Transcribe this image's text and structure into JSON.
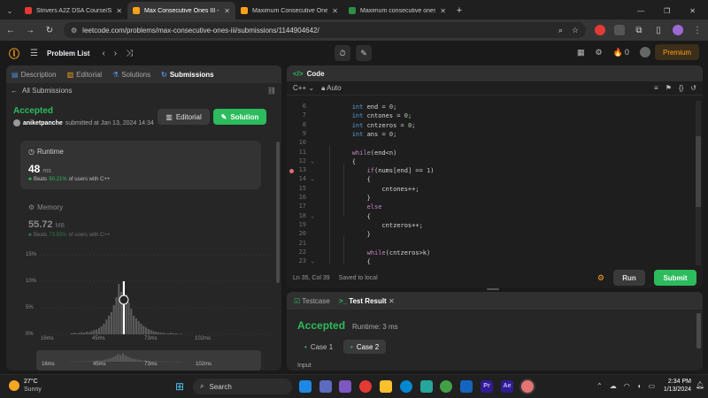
{
  "browser": {
    "tabs": [
      {
        "title": "Strivers A2Z DSA Course/Sheet",
        "color": "#e53935"
      },
      {
        "title": "Max Consecutive Ones III - Leet",
        "color": "#ffa116"
      },
      {
        "title": "Maximum Consecutive Ones - L",
        "color": "#ffa116"
      },
      {
        "title": "Maximum consecutive ones for",
        "color": "#2f8d46"
      }
    ],
    "url": "leetcode.com/problems/max-consecutive-ones-iii/submissions/1144904642/"
  },
  "header": {
    "problem_list": "Problem List",
    "fire_count": "0",
    "premium": "Premium"
  },
  "left": {
    "tabs": [
      "Description",
      "Editorial",
      "Solutions",
      "Submissions"
    ],
    "back_label": "All Submissions",
    "status": "Accepted",
    "user": "aniketpanche",
    "submitted": "submitted at Jan 13, 2024 14:34",
    "editorial_btn": "Editorial",
    "solution_btn": "Solution",
    "runtime": {
      "label": "Runtime",
      "value": "48",
      "unit": "ms",
      "beats_prefix": "Beats",
      "beats_pct": "50.21%",
      "beats_suffix": "of users with C++"
    },
    "memory": {
      "label": "Memory",
      "value": "55.72",
      "unit": "MB",
      "beats_prefix": "Beats",
      "beats_pct": "73.83%",
      "beats_suffix": "of users with C++"
    }
  },
  "chart_data": {
    "type": "bar",
    "y_ticks": [
      "15%",
      "10%",
      "5%",
      "0%"
    ],
    "x_ticks": [
      "16ms",
      "45ms",
      "73ms",
      "102ms"
    ],
    "ylim": [
      0,
      15
    ],
    "bars": [
      0.2,
      0.3,
      0.2,
      0.3,
      0.4,
      0.3,
      0.5,
      0.4,
      0.6,
      0.8,
      0.9,
      1.2,
      1.5,
      2,
      2.8,
      3.5,
      4.2,
      5.5,
      7,
      9.5,
      8,
      10,
      7.5,
      6,
      4.8,
      3.5,
      3,
      2.5,
      2,
      1.6,
      1.3,
      1,
      0.8,
      0.6,
      0.5,
      0.4,
      0.3,
      0.3,
      0.2,
      0.2,
      0.3,
      0.2,
      0.2,
      0.1,
      0.1
    ],
    "highlight_index": 21,
    "mini_x_ticks": [
      "16ms",
      "45ms",
      "73ms",
      "102ms"
    ]
  },
  "code": {
    "title": "Code",
    "language": "C++",
    "auto": "Auto",
    "lines": [
      {
        "n": "6",
        "html": "        <span class='kw'>int</span> end = <span class='num'>0</span>;"
      },
      {
        "n": "7",
        "html": "        <span class='kw'>int</span> cntones = <span class='num'>0</span>;"
      },
      {
        "n": "8",
        "html": "        <span class='kw'>int</span> cntzeros = <span class='num'>0</span>;"
      },
      {
        "n": "9",
        "html": "        <span class='kw'>int</span> ans = <span class='num'>0</span>;"
      },
      {
        "n": "10",
        "html": ""
      },
      {
        "n": "11",
        "html": "        <span class='ctl'>while</span>(end&lt;n)"
      },
      {
        "n": "12",
        "html": "        {"
      },
      {
        "n": "13",
        "html": "            <span class='ctl'>if</span>(nums[end] == <span class='num'>1</span>)"
      },
      {
        "n": "14",
        "html": "            {"
      },
      {
        "n": "15",
        "html": "                cntones++;"
      },
      {
        "n": "16",
        "html": "            }"
      },
      {
        "n": "17",
        "html": "            <span class='ctl'>else</span>"
      },
      {
        "n": "18",
        "html": "            {"
      },
      {
        "n": "19",
        "html": "                cntzeros++;"
      },
      {
        "n": "20",
        "html": "            }"
      },
      {
        "n": "21",
        "html": ""
      },
      {
        "n": "22",
        "html": "            <span class='ctl'>while</span>(cntzeros&gt;k)"
      },
      {
        "n": "23",
        "html": "            {"
      }
    ],
    "status": "Ln 35, Col 39",
    "saved": "Saved to local",
    "run": "Run",
    "submit": "Submit"
  },
  "result": {
    "tab_testcase": "Testcase",
    "tab_result": "Test Result",
    "status": "Accepted",
    "runtime": "Runtime: 3 ms",
    "case1": "Case 1",
    "case2": "Case 2",
    "input_label": "Input"
  },
  "taskbar": {
    "temp": "27°C",
    "weather": "Sunny",
    "search": "Search",
    "time": "2:34 PM",
    "date": "1/13/2024"
  }
}
